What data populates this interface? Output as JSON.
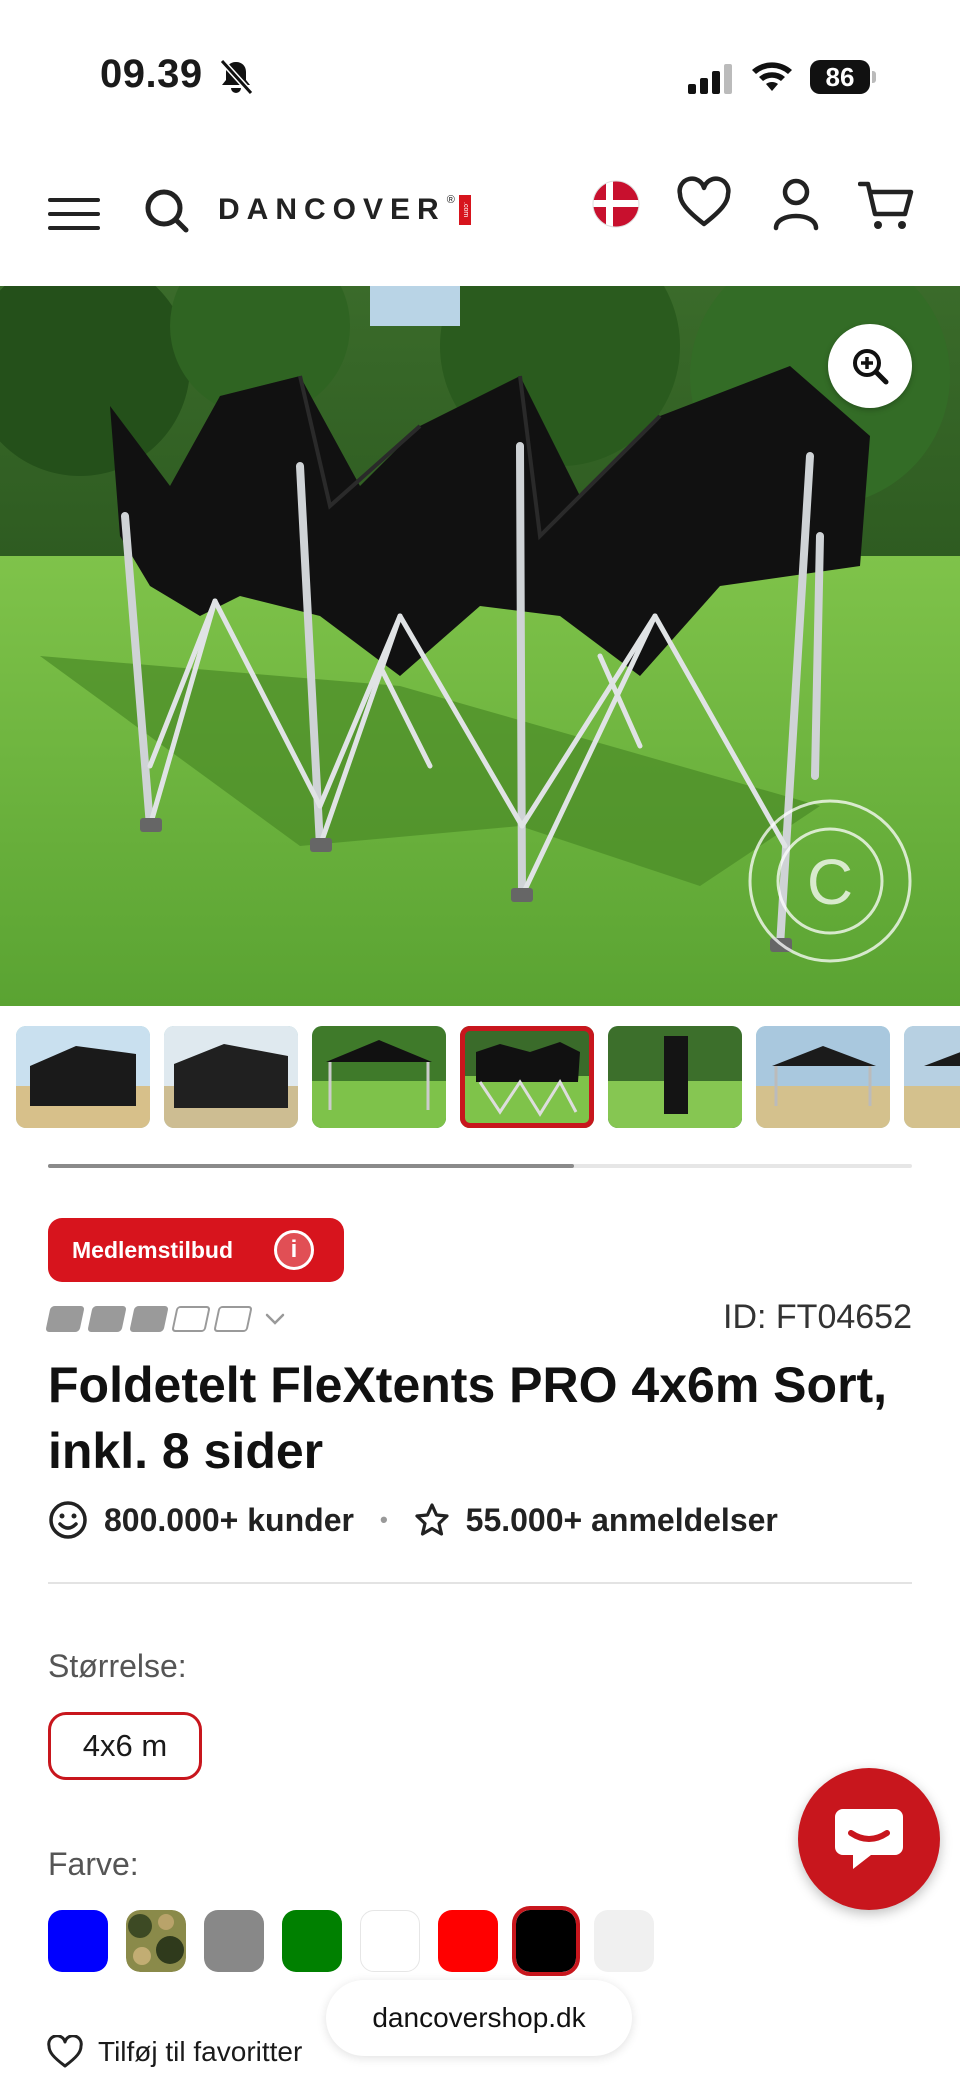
{
  "status_bar": {
    "time": "09.39",
    "battery": "86"
  },
  "header": {
    "logo_text": "DANCOVER",
    "logo_reg": "®",
    "logo_tag": ".com"
  },
  "gallery": {
    "thumbnail_count": 7,
    "selected_index": 3
  },
  "product": {
    "badge_label": "Medlemstilbud",
    "badge_info": "i",
    "rating_filled": 3,
    "rating_total": 5,
    "id": "ID: FT04652",
    "title": "Foldetelt FleXtents PRO 4x6m Sort, inkl. 8 sider",
    "customers": "800.000+ kunder",
    "separator": "•",
    "reviews": "55.000+ anmeldelser"
  },
  "size": {
    "label": "Størrelse:",
    "selected": "4x6 m"
  },
  "color": {
    "label": "Farve:",
    "swatches": [
      "#0000ff",
      "camouflage",
      "#888888",
      "#008000",
      "#ffffff",
      "#ff0000",
      "#000000",
      "#f0f0f0"
    ],
    "selected_index": 6
  },
  "favorite_label": "Tilføj til favoritter",
  "browser": {
    "url": "dancovershop.dk"
  },
  "colors": {
    "accent": "#d7141d",
    "accent_dark": "#c8161d"
  }
}
